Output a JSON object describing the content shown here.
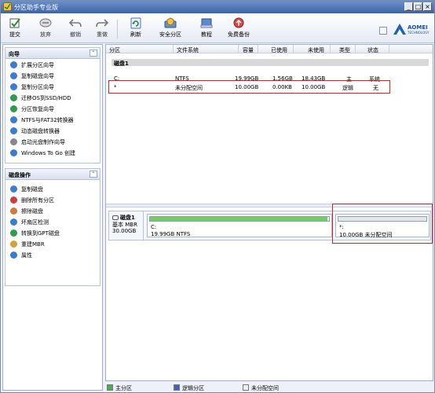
{
  "window": {
    "title": "分区助手专业版",
    "buttons": [
      "_",
      "□",
      "×"
    ]
  },
  "toolbar": {
    "items": [
      {
        "label": "提交",
        "icon": "submit-check-icon"
      },
      {
        "label": "放弃",
        "icon": "discard-icon"
      },
      {
        "label": "撤销",
        "icon": "undo-icon"
      },
      {
        "label": "重做",
        "icon": "redo-icon"
      },
      {
        "label": "刷新",
        "icon": "refresh-icon"
      },
      {
        "label": "安全分区",
        "icon": "safe-partition-icon"
      },
      {
        "label": "教程",
        "icon": "tutorial-icon"
      },
      {
        "label": "免费备份",
        "icon": "free-backup-icon"
      }
    ],
    "logo": {
      "brand": "AOMEI",
      "sub": "TECHNOLOGY"
    }
  },
  "sidebar": {
    "wizard": {
      "title": "向导",
      "items": [
        {
          "label": "扩展分区向导",
          "icon": "extend-wizard-icon",
          "color": "#3b7cd1"
        },
        {
          "label": "复制磁盘向导",
          "icon": "copy-disk-icon",
          "color": "#3b7cd1"
        },
        {
          "label": "复制分区向导",
          "icon": "copy-partition-icon",
          "color": "#3b7cd1"
        },
        {
          "label": "迁移OS到SSD/HDD",
          "icon": "migrate-os-icon",
          "color": "#2e9c4a"
        },
        {
          "label": "分区恢复向导",
          "icon": "recovery-icon",
          "color": "#2e9c4a"
        },
        {
          "label": "NTFS与FAT32转换器",
          "icon": "convert-icon",
          "color": "#3b7cd1"
        },
        {
          "label": "动态磁盘转换器",
          "icon": "dynamic-disk-icon",
          "color": "#3b7cd1"
        },
        {
          "label": "启动光盘制作向导",
          "icon": "bootable-cd-icon",
          "color": "#888888"
        },
        {
          "label": "Windows To Go 创建",
          "icon": "windows-to-go-icon",
          "color": "#3b7cd1"
        }
      ]
    },
    "disk_ops": {
      "title": "磁盘操作",
      "items": [
        {
          "label": "复制磁盘",
          "icon": "copy-disk-icon",
          "color": "#3b7cd1"
        },
        {
          "label": "删除所有分区",
          "icon": "delete-all-icon",
          "color": "#d13b3b"
        },
        {
          "label": "擦除磁盘",
          "icon": "wipe-disk-icon",
          "color": "#d17b3b"
        },
        {
          "label": "坏扇区检测",
          "icon": "bad-sector-icon",
          "color": "#3b7cd1"
        },
        {
          "label": "转换到GPT磁盘",
          "icon": "convert-gpt-icon",
          "color": "#2e9c4a"
        },
        {
          "label": "重建MBR",
          "icon": "rebuild-mbr-icon",
          "color": "#d1a23b"
        },
        {
          "label": "属性",
          "icon": "properties-icon",
          "color": "#3b7cd1"
        }
      ]
    }
  },
  "table": {
    "headers": [
      "分区",
      "文件系统",
      "容量",
      "已使用",
      "未使用",
      "类型",
      "状态"
    ],
    "disk_label": "磁盘1",
    "rows": [
      [
        "C:",
        "NTFS",
        "19.99GB",
        "1.56GB",
        "18.43GB",
        "主",
        "系统"
      ],
      [
        "*",
        "未分配空间",
        "10.00GB",
        "0.00KB",
        "10.00GB",
        "逻辑",
        "无"
      ]
    ]
  },
  "disk_map": {
    "disk_name": "磁盘1",
    "disk_type": "基本 MBR",
    "disk_size": "30.00GB",
    "partitions": [
      {
        "name": "C:",
        "info": "19.99GB NTFS",
        "used_fraction": 0.99,
        "color": "#6fcf5a"
      },
      {
        "name": "*:",
        "info": "10.00GB 未分配空间",
        "used_fraction": 0.0,
        "color": "#e6e6e6"
      }
    ]
  },
  "legend": [
    {
      "label": "主分区",
      "color": "#44b24a"
    },
    {
      "label": "逻辑分区",
      "color": "#3b63c4"
    },
    {
      "label": "未分配空间",
      "color": "#f0f0f0"
    }
  ]
}
